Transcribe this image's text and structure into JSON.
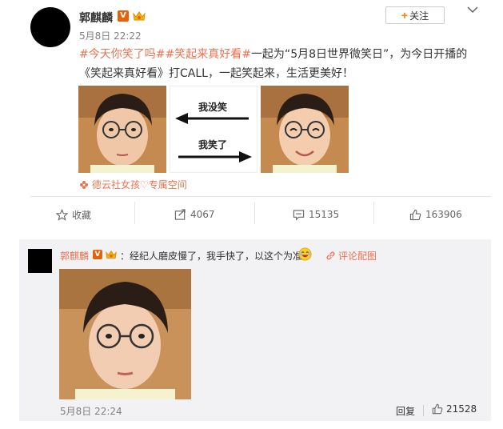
{
  "post": {
    "username": "郭麒麟",
    "verified_badge": "V",
    "timestamp": "5月8日 22:22",
    "follow_label": "关注",
    "text_parts": {
      "tag1": "#今天你笑了吗#",
      "tag2": "#笑起来真好看#",
      "body": "一起为“5月8日世界微笑日”，为今日开播的《笑起来真好看》打CALL，一起笑起来，生活更美好！"
    },
    "meme": {
      "top_text": "我没笑",
      "bottom_text": "我笑了"
    },
    "source": "德云社女孩♡专属空间"
  },
  "actions": {
    "favorite_label": "收藏",
    "repost_count": "4067",
    "comment_count": "15135",
    "like_count": "163906"
  },
  "comment": {
    "username": "郭麒麟",
    "verified_badge": "V",
    "text": "：经纪人磨皮慢了，我手快了，以这个为准",
    "pic_link_label": "评论配图",
    "timestamp": "5月8日 22:24",
    "reply_label": "回复",
    "like_count": "21528"
  },
  "colors": {
    "accent": "#eb7350",
    "badge": "#e5620b",
    "follow_plus": "#ff8200"
  },
  "icons": [
    "crown-icon",
    "chevron-down-icon",
    "star-icon",
    "repost-icon",
    "comment-icon",
    "thumbs-up-icon",
    "link-icon",
    "laugh-emoji-icon"
  ]
}
